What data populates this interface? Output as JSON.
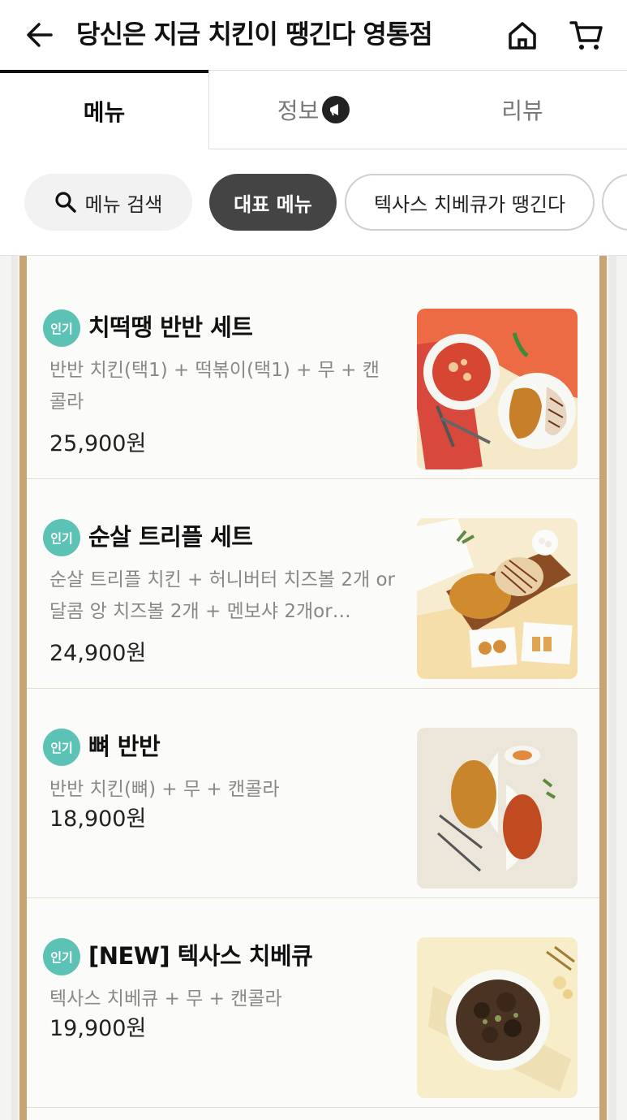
{
  "header": {
    "title": "당신은 지금 치킨이 땡긴다 영통점",
    "icons": {
      "back": "arrow-left-icon",
      "home": "home-icon",
      "cart": "cart-icon"
    }
  },
  "tabs": [
    {
      "label": "메뉴",
      "active": true
    },
    {
      "label": "정보",
      "active": false,
      "icon": "megaphone-icon"
    },
    {
      "label": "리뷰",
      "active": false
    }
  ],
  "chips": {
    "search": "메뉴 검색",
    "items": [
      "대표 메뉴",
      "텍사스 치베큐가 땡긴다"
    ],
    "selected": "대표 메뉴"
  },
  "menu": {
    "popular_badge": "인기",
    "items": [
      {
        "name": "치떡땡 반반 세트",
        "desc": "반반 치킨(택1) + 떡볶이(택1) + 무 + 캔콜라",
        "price": "25,900원"
      },
      {
        "name": "순살 트리플 세트",
        "desc": "순살 트리플 치킨 + 허니버터 치즈볼 2개 or달콤 앙 치즈볼 2개 + 멘보샤 2개or…",
        "price": "24,900원"
      },
      {
        "name": "뼈 반반",
        "desc": "반반 치킨(뼈) + 무 + 캔콜라",
        "price": "18,900원"
      },
      {
        "name": "[NEW] 텍사스 치베큐",
        "desc": "텍사스 치베큐 + 무 + 캔콜라",
        "price": "19,900원"
      }
    ]
  },
  "colors": {
    "accent_badge": "#5cc2b6",
    "selected_chip": "#444444",
    "frame": "#c8a373"
  }
}
